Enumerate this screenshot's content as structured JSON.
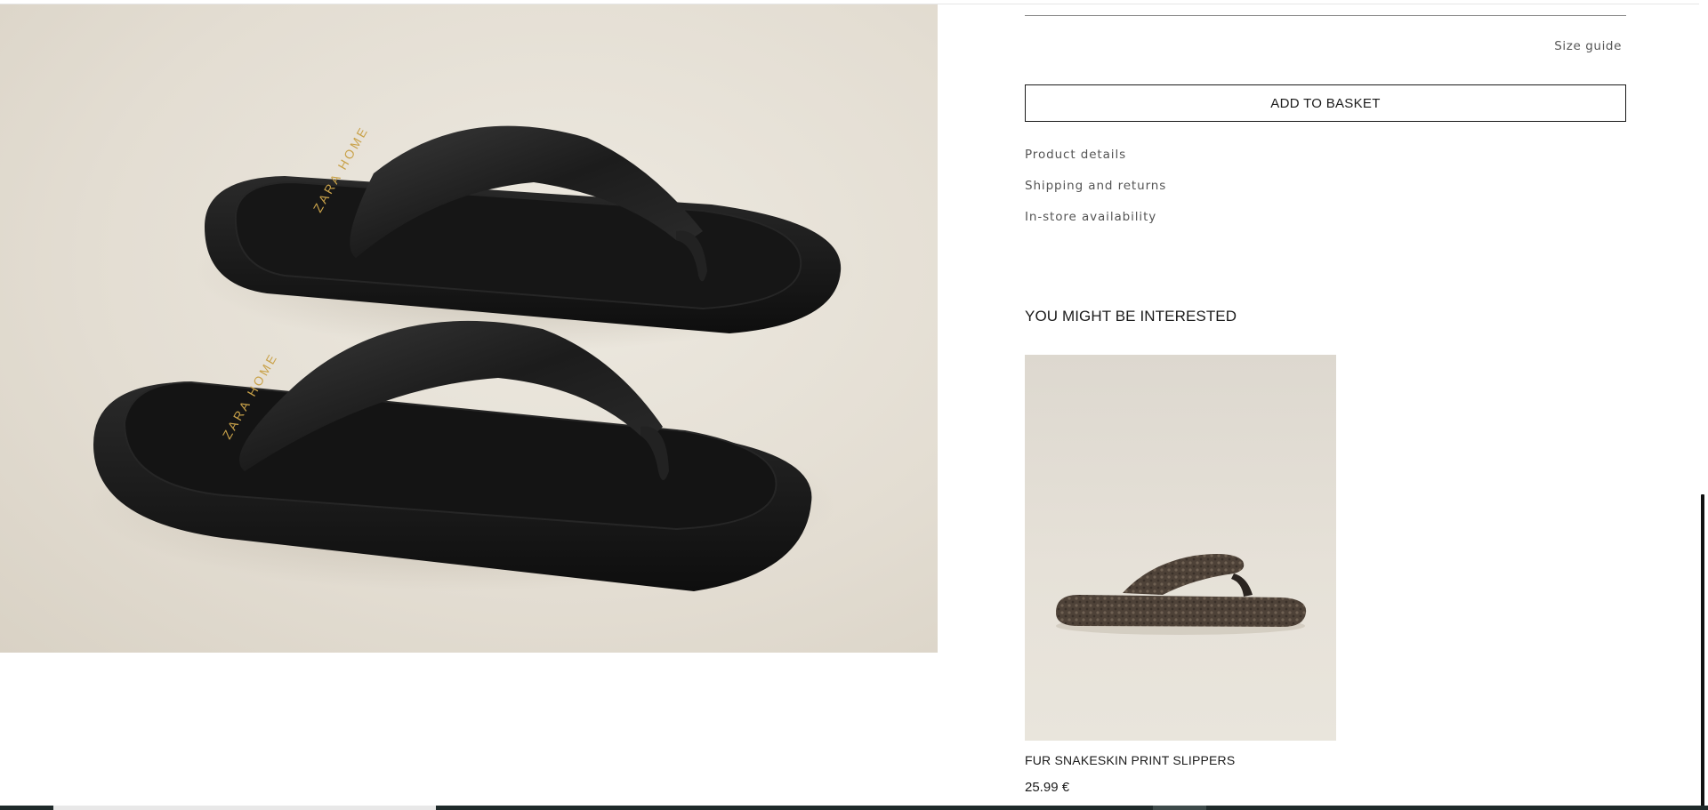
{
  "product": {
    "image_icon": "black-padded-flip-flop-sandals-image",
    "insole_brand_left": "ZARA HOME",
    "insole_brand_right": "ZARA HOME"
  },
  "sizing": {
    "size_guide_label": "Size guide"
  },
  "actions": {
    "add_to_basket_label": "ADD TO BASKET"
  },
  "info_links": [
    {
      "label": "Product details"
    },
    {
      "label": "Shipping and returns"
    },
    {
      "label": "In-store availability"
    }
  ],
  "recommendations": {
    "title": "YOU MIGHT BE INTERESTED",
    "items": [
      {
        "name": "FUR SNAKESKIN PRINT SLIPPERS",
        "price": "25.99 €",
        "image_icon": "snakeskin-fur-slipper-image"
      }
    ]
  },
  "colors": {
    "accent": "#1a1a1a",
    "image_background": "#e6e1d8",
    "muted_text": "#555555"
  }
}
